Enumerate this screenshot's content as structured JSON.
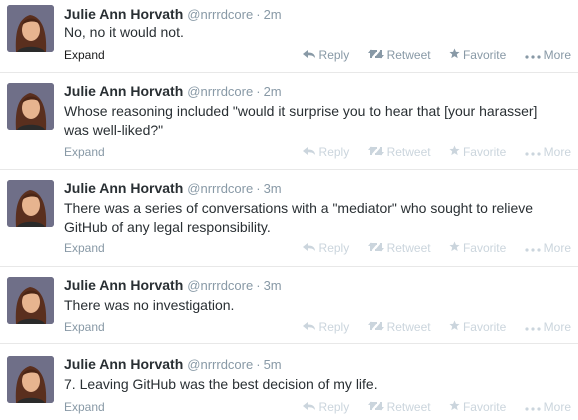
{
  "tweets": [
    {
      "name": "Julie Ann Horvath",
      "handle": "@nrrrdcore",
      "time": "2m",
      "text": "No, no it would not.",
      "expand": "Expand",
      "actions": {
        "reply": "Reply",
        "retweet": "Retweet",
        "favorite": "Favorite",
        "more": "More"
      }
    },
    {
      "name": "Julie Ann Horvath",
      "handle": "@nrrrdcore",
      "time": "2m",
      "text": "Whose reasoning included \"would it surprise you to hear that [your harasser] was well-liked?\"",
      "expand": "Expand",
      "actions": {
        "reply": "Reply",
        "retweet": "Retweet",
        "favorite": "Favorite",
        "more": "More"
      }
    },
    {
      "name": "Julie Ann Horvath",
      "handle": "@nrrrdcore",
      "time": "3m",
      "text": "There was a series of conversations with a \"mediator\" who sought to relieve GitHub of any legal responsibility.",
      "expand": "Expand",
      "actions": {
        "reply": "Reply",
        "retweet": "Retweet",
        "favorite": "Favorite",
        "more": "More"
      }
    },
    {
      "name": "Julie Ann Horvath",
      "handle": "@nrrrdcore",
      "time": "3m",
      "text": "There was no investigation.",
      "expand": "Expand",
      "actions": {
        "reply": "Reply",
        "retweet": "Retweet",
        "favorite": "Favorite",
        "more": "More"
      }
    },
    {
      "name": "Julie Ann Horvath",
      "handle": "@nrrrdcore",
      "time": "5m",
      "text": "7. Leaving GitHub was the best decision of my life.",
      "expand": "Expand",
      "actions": {
        "reply": "Reply",
        "retweet": "Retweet",
        "favorite": "Favorite",
        "more": "More"
      }
    }
  ],
  "colors": {
    "name": "#292f33",
    "meta": "#8899a6",
    "faded_action": "#cbd5dd",
    "divider": "#e8e8e8"
  },
  "icons": [
    "reply-icon",
    "retweet-icon",
    "favorite-icon",
    "more-icon",
    "avatar"
  ]
}
